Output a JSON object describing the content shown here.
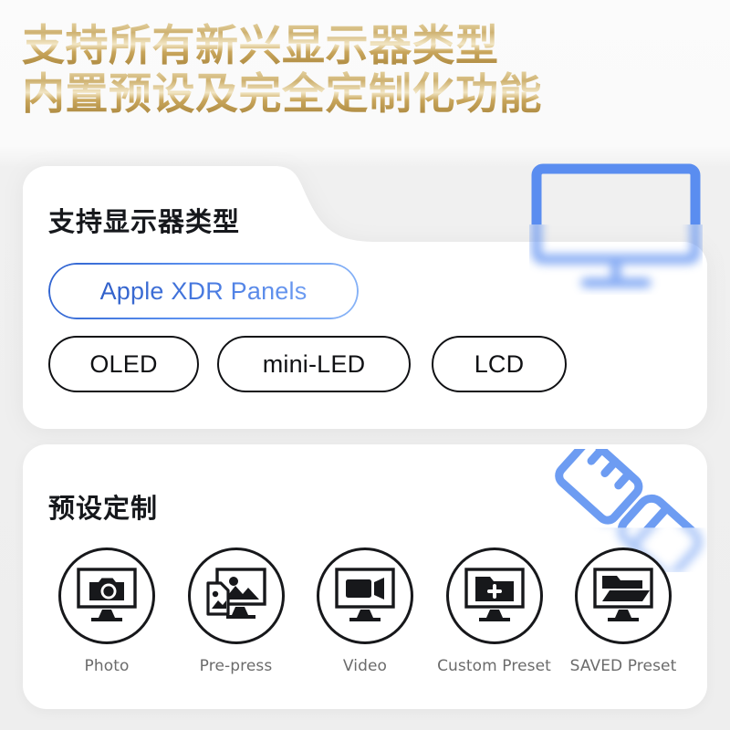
{
  "headline": {
    "line1": "支持所有新兴显示器类型",
    "line2": "内置预设及完全定制化功能",
    "gradient_from": "#e4d2a1",
    "gradient_to": "#b08d44"
  },
  "panel_card": {
    "title": "支持显示器类型",
    "accent_color": "#3d74e0",
    "pills": [
      {
        "label": "Apple XDR Panels",
        "style": "accent"
      },
      {
        "label": "OLED",
        "style": "outline"
      },
      {
        "label": "mini-LED",
        "style": "outline"
      },
      {
        "label": "LCD",
        "style": "outline"
      }
    ],
    "decoration_icon": "monitor-icon",
    "decoration_color": "#5a8df0"
  },
  "preset_card": {
    "title": "预设定制",
    "decoration_icon": "ruler-pencil-icon",
    "decoration_color": "#6d9cf2",
    "presets": [
      {
        "label": "Photo",
        "icon": "monitor-camera-icon"
      },
      {
        "label": "Pre-press",
        "icon": "monitor-image-document-icon"
      },
      {
        "label": "Video",
        "icon": "monitor-video-camera-icon"
      },
      {
        "label": "Custom Preset",
        "icon": "monitor-folder-plus-icon"
      },
      {
        "label": "SAVED Preset",
        "icon": "monitor-folder-open-icon"
      }
    ]
  }
}
